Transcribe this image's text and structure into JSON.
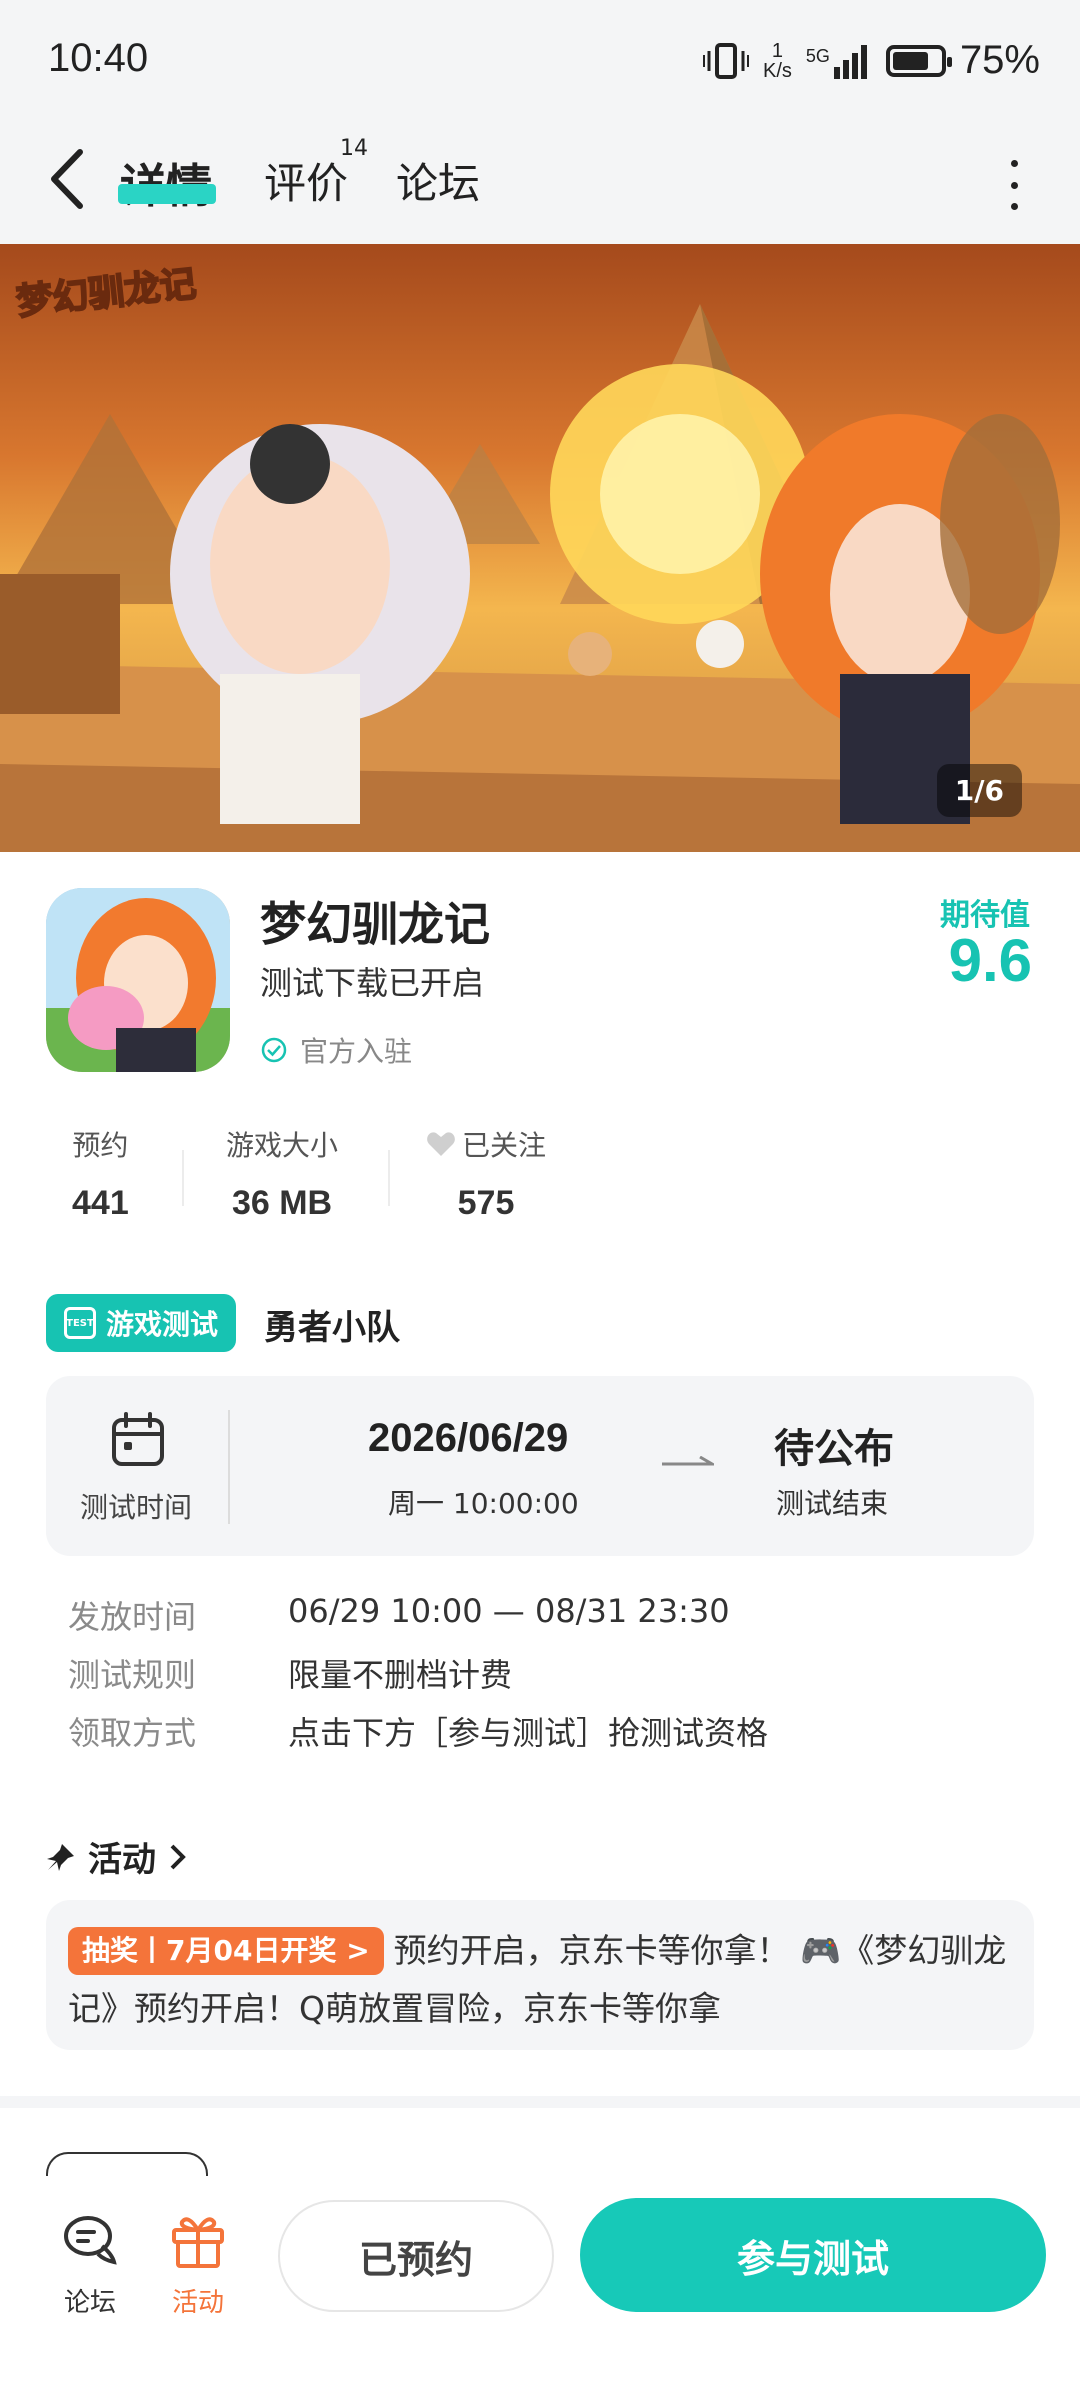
{
  "status_bar": {
    "time": "10:40",
    "speed_value": "1",
    "speed_unit": "K/s",
    "network": "5G",
    "battery_pct": "75%",
    "battery_level": 0.75
  },
  "nav": {
    "tabs": [
      {
        "label": "详情",
        "active": true
      },
      {
        "label": "评价",
        "badge": "14"
      },
      {
        "label": "论坛"
      }
    ]
  },
  "banner": {
    "logo_text": "梦幻驯龙记",
    "page_indicator": "1/6"
  },
  "app": {
    "title": "梦幻驯龙记",
    "subtitle": "测试下载已开启",
    "official": "官方入驻",
    "expect_label": "期待值",
    "expect_value": "9.6"
  },
  "stats": [
    {
      "label": "预约",
      "value": "441"
    },
    {
      "label": "游戏大小",
      "value": "36 MB"
    },
    {
      "label": "已关注",
      "value": "575"
    }
  ],
  "test": {
    "tag_label": "游戏测试",
    "tag_icon_text": "TEST",
    "name": "勇者小队",
    "time_label": "测试时间",
    "start_date": "2026/06/29",
    "start_sub": "周一  10:00:00",
    "end_main": "待公布",
    "end_sub": "测试结束",
    "details": [
      {
        "key": "发放时间",
        "value": "06/29 10:00 — 08/31 23:30"
      },
      {
        "key": "测试规则",
        "value": "限量不删档计费"
      },
      {
        "key": "领取方式",
        "value": "点击下方［参与测试］抢测试资格"
      }
    ]
  },
  "activity": {
    "header": "活动",
    "badge": "抽奖丨7月04日开奖 >",
    "text": "预约开启，京东卡等你拿！ 🎮《梦幻驯龙记》预约开启！Q萌放置冒险，京东卡等你拿"
  },
  "bottom_bar": {
    "forum_label": "论坛",
    "activity_label": "活动",
    "reserved_label": "已预约",
    "join_label": "参与测试"
  },
  "colors": {
    "accent": "#17c3b2",
    "orange": "#f4743a",
    "bg_gray": "#f4f5f7"
  }
}
